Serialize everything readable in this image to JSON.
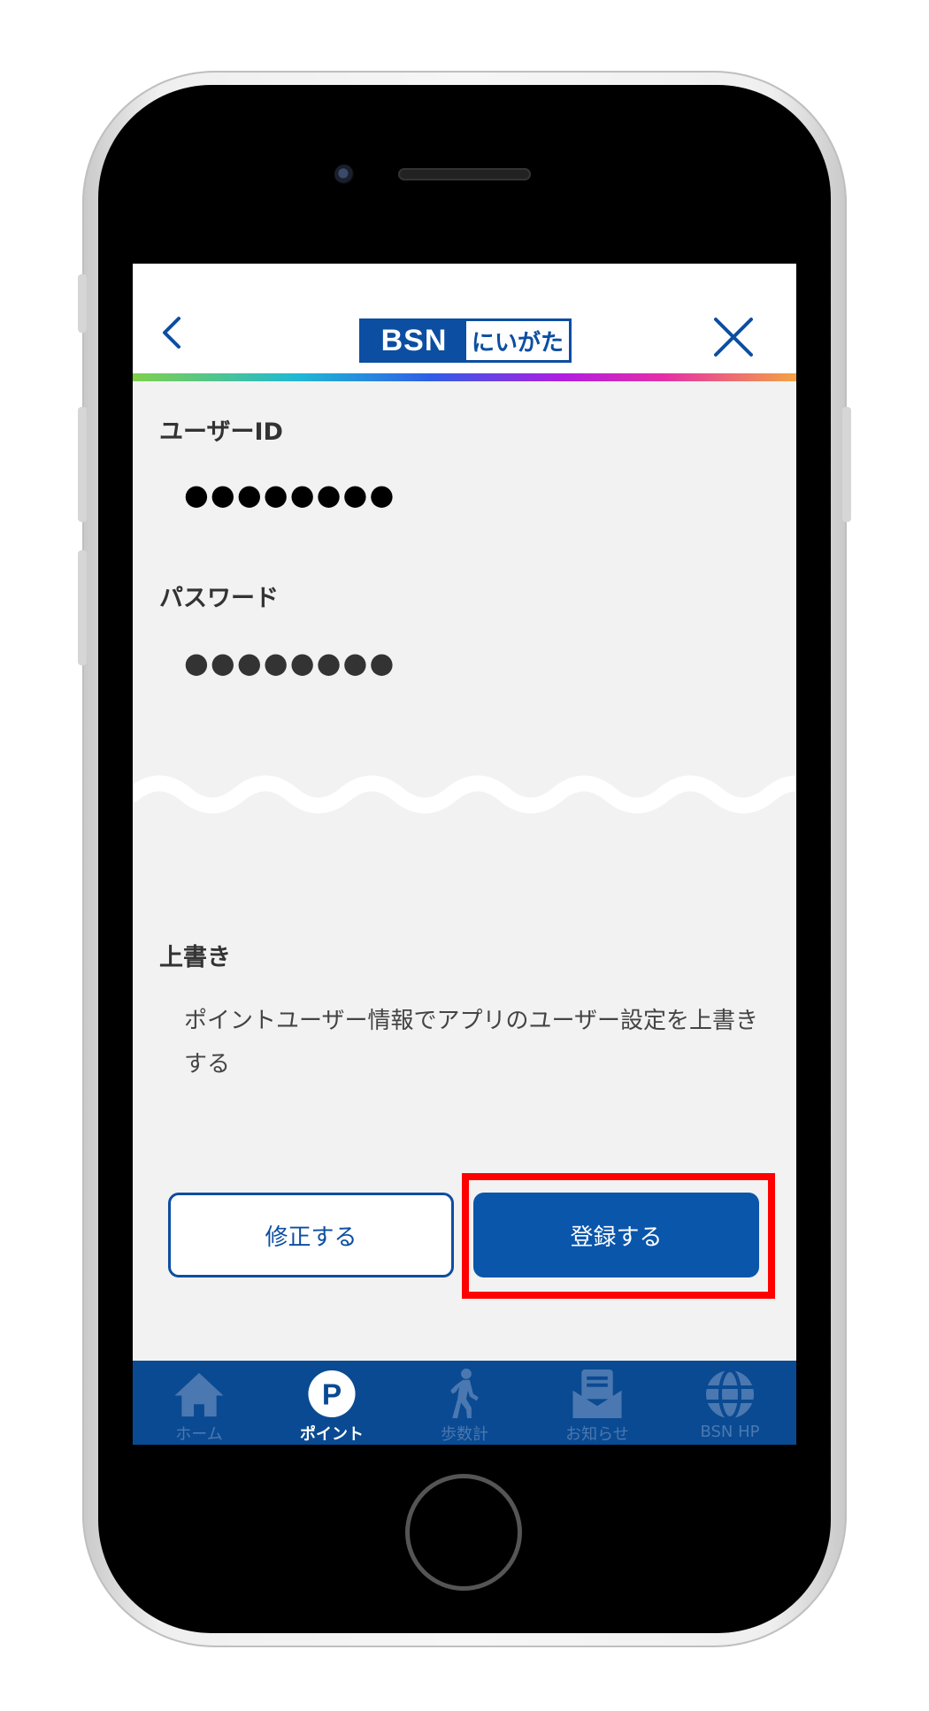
{
  "header": {
    "logo_brand": "BSN",
    "logo_city": "にいがた"
  },
  "fields": [
    {
      "label": "ユーザーID",
      "value": "●●●●●●●●"
    },
    {
      "label": "パスワード",
      "value": "●●●●●●●●"
    }
  ],
  "overwrite": {
    "label": "上書き",
    "description": "ポイントユーザー情報でアプリのユーザー設定を上書きする"
  },
  "buttons": {
    "edit": "修正する",
    "register": "登録する"
  },
  "tabs": [
    {
      "label": "ホーム",
      "icon": "home-icon",
      "active": false
    },
    {
      "label": "ポイント",
      "icon": "point-icon",
      "active": true
    },
    {
      "label": "歩数計",
      "icon": "walker-icon",
      "active": false
    },
    {
      "label": "お知らせ",
      "icon": "mail-icon",
      "active": false
    },
    {
      "label": "BSN HP",
      "icon": "globe-icon",
      "active": false
    }
  ],
  "colors": {
    "brand_blue": "#0c4ea2",
    "tabbar": "#0a4a92",
    "highlight": "#ff0000"
  }
}
